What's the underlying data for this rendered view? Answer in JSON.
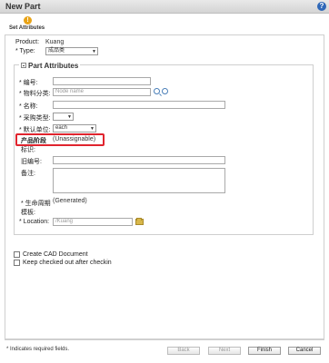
{
  "window": {
    "title": "New Part"
  },
  "steps": {
    "current_label": "Set Attributes",
    "current_icon_text": "!"
  },
  "product": {
    "label": "Product:",
    "value": "Kuang"
  },
  "type": {
    "label": "* Type:",
    "selected": "成品类"
  },
  "group": {
    "title": "Part Attributes"
  },
  "fields": {
    "number_label": "编号:",
    "classification_label": "物料分类:",
    "classification_placeholder": "Node name",
    "name_label": "名称:",
    "procurement_label": "采购类型:",
    "unit_label": "默认单位:",
    "unit_selected": "each",
    "stage_label": "产品阶段",
    "stage_label_wrap": "标识:",
    "stage_value": "(Unassignable)",
    "old_number_label": "旧编号:",
    "remark_label": "备注:",
    "lifecycle_label": "生命周期",
    "lifecycle_label_wrap": "模板:",
    "lifecycle_value": "(Generated)",
    "location_label": "Location:",
    "location_placeholder": "/Kuang"
  },
  "checkboxes": {
    "create_cad": "Create CAD Document",
    "keep_checked_out": "Keep checked out after checkin"
  },
  "footer": {
    "note": "* Indicates required fields.",
    "back": "Back",
    "next": "Next",
    "finish": "Finish",
    "cancel": "Cancel"
  },
  "colors": {
    "highlight": "#e0242e",
    "step_icon": "#e8a317",
    "help_icon": "#2f68b8"
  }
}
